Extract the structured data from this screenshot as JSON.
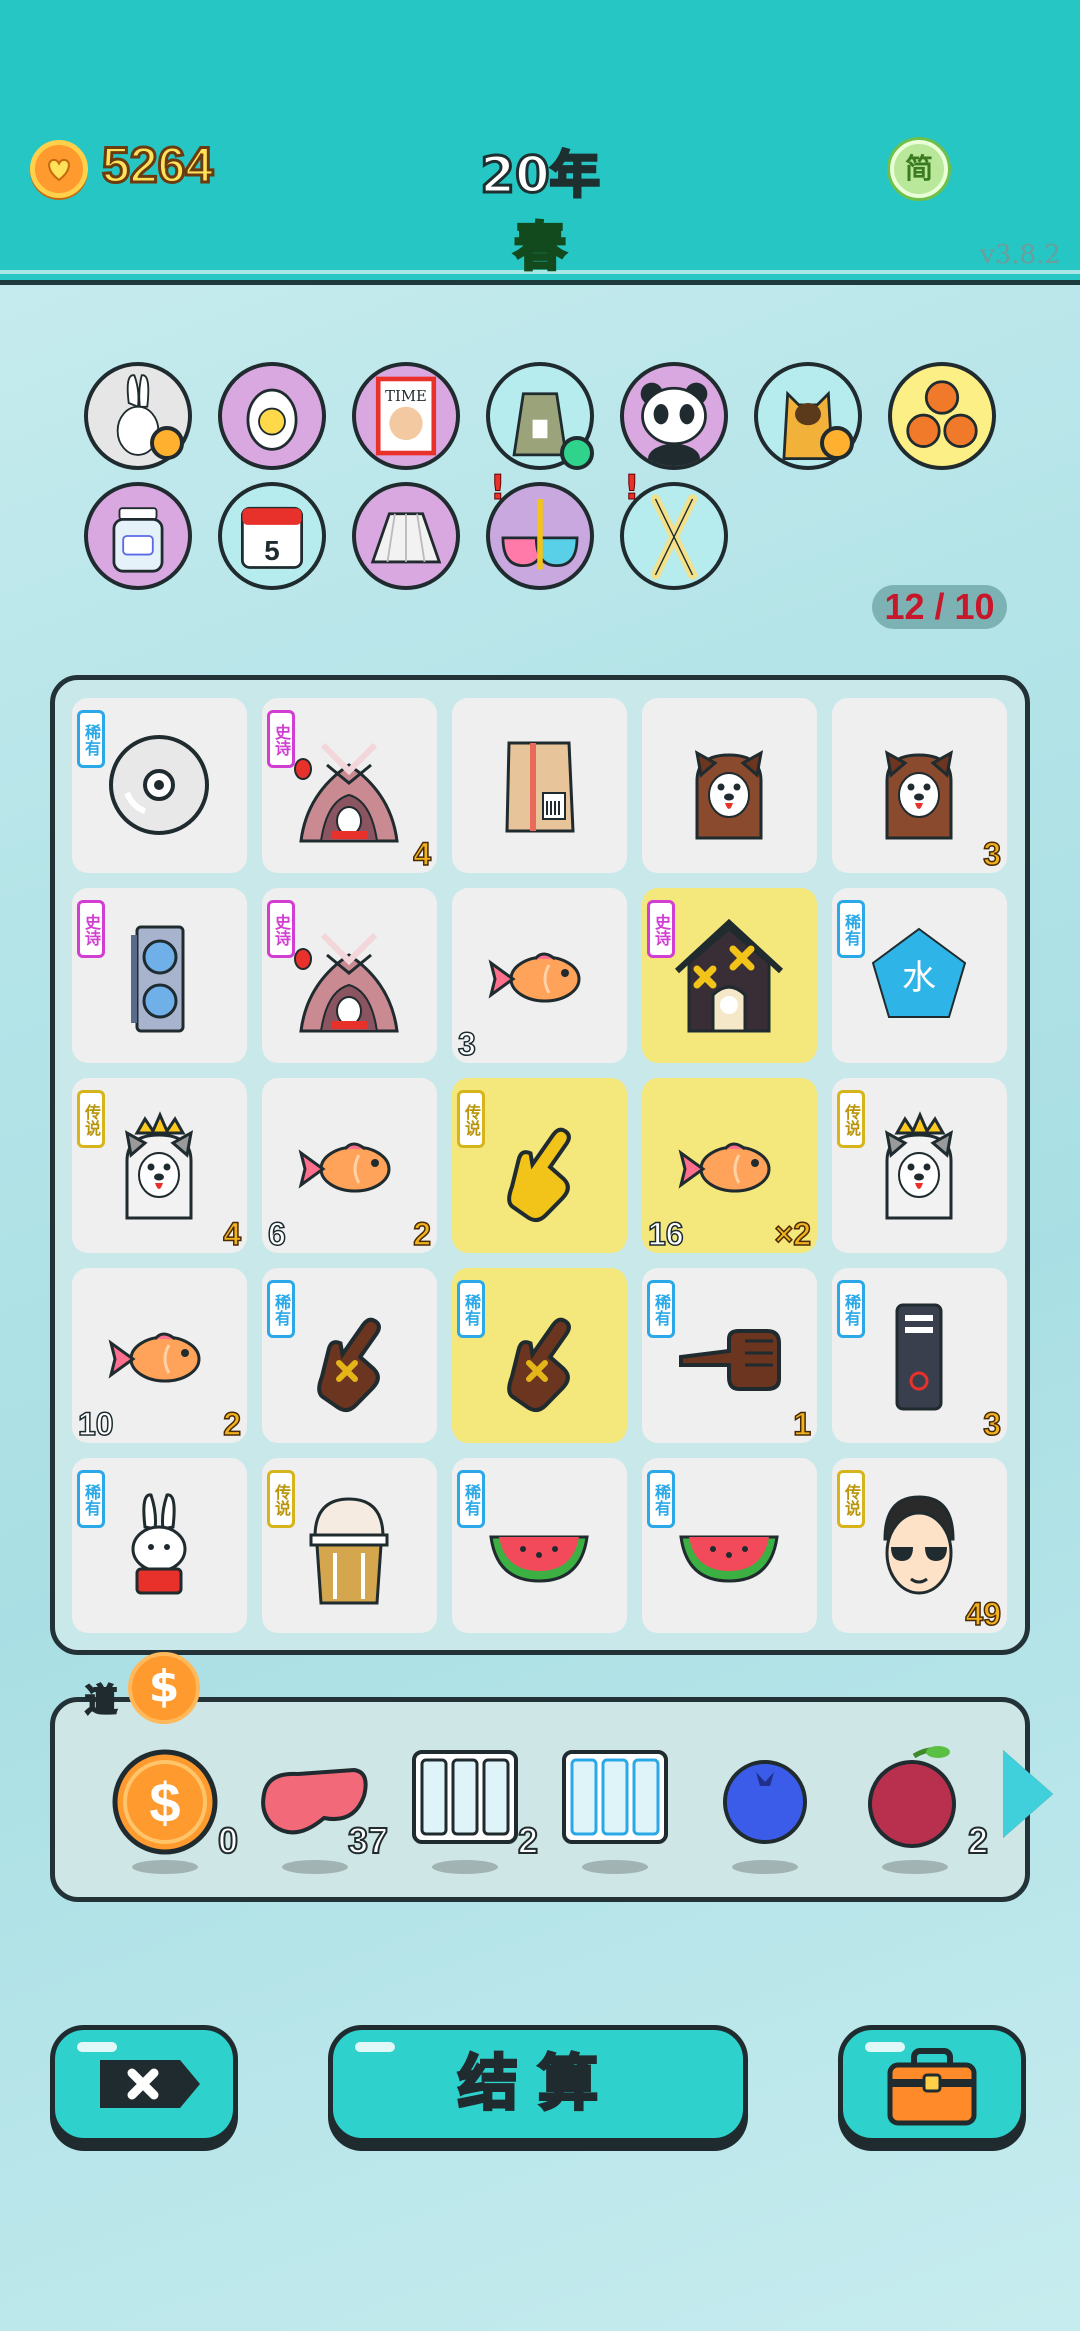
{
  "header": {
    "coins": "5264",
    "year": "20年",
    "season": "春",
    "lang_toggle": "简",
    "version": "v3.8.2"
  },
  "relics": [
    {
      "name": "rabbit-relic",
      "icon": "rabbit-icon",
      "bg": "#e6e6e6",
      "badge": true
    },
    {
      "name": "egg-relic",
      "icon": "egg-icon",
      "bg": "#d9a8e0"
    },
    {
      "name": "magazine-relic",
      "icon": "time-magazine-icon",
      "bg": "#d9a8e0",
      "text": "TIME"
    },
    {
      "name": "sack-relic",
      "icon": "sack-icon",
      "bg": "#b7ecee",
      "dot": true
    },
    {
      "name": "panda-relic",
      "icon": "panda-icon",
      "bg": "#d9a8e0"
    },
    {
      "name": "cat-relic",
      "icon": "cat-icon",
      "bg": "#b7ecee",
      "badge": true
    },
    {
      "name": "basketballs-relic",
      "icon": "basketballs-icon",
      "bg": "#fbef86"
    },
    {
      "name": "jar-relic",
      "icon": "jar-icon",
      "bg": "#d9a8e0"
    },
    {
      "name": "calendar-relic",
      "icon": "calendar-icon",
      "bg": "#b7ecee",
      "text": "5"
    },
    {
      "name": "skirt-relic",
      "icon": "skirt-icon",
      "bg": "#d9a8e0"
    },
    {
      "name": "bowls-relic",
      "icon": "bowls-icon",
      "bg": "#c9a8e0",
      "alert": true
    },
    {
      "name": "sticks-relic",
      "icon": "sticks-icon",
      "bg": "#b7ecee",
      "alert": true
    }
  ],
  "relic_counter": "12 / 10",
  "board": [
    [
      {
        "icon": "cd-disc-icon",
        "rarity": "稀有",
        "rclass": "r-rare"
      },
      {
        "icon": "rabbit-tent-icon",
        "rarity": "史诗",
        "rclass": "r-epic",
        "br": "4"
      },
      {
        "icon": "cardboard-box-icon"
      },
      {
        "icon": "husky-dog-icon"
      },
      {
        "icon": "husky-dog-icon",
        "br": "3"
      }
    ],
    [
      {
        "icon": "graphics-card-icon",
        "rarity": "史诗",
        "rclass": "r-epic"
      },
      {
        "icon": "rabbit-tent-icon",
        "rarity": "史诗",
        "rclass": "r-epic"
      },
      {
        "icon": "goldfish-icon",
        "bl": "3"
      },
      {
        "icon": "haunted-house-icon",
        "rarity": "史诗",
        "rclass": "r-epic",
        "hl": true
      },
      {
        "icon": "water-gem-icon",
        "rarity": "稀有",
        "rclass": "r-rare",
        "text": "水"
      }
    ],
    [
      {
        "icon": "crowned-husky-icon",
        "rarity": "传说",
        "rclass": "r-leg",
        "br": "4"
      },
      {
        "icon": "goldfish-icon",
        "bl": "6",
        "br": "2"
      },
      {
        "icon": "golden-pointer-icon",
        "rarity": "传说",
        "rclass": "r-leg",
        "hl": true
      },
      {
        "icon": "goldfish-icon",
        "bl": "16",
        "br": "×2",
        "hl": true
      },
      {
        "icon": "crowned-husky-icon",
        "rarity": "传说",
        "rclass": "r-leg"
      }
    ],
    [
      {
        "icon": "goldfish-icon",
        "bl": "10",
        "br": "2"
      },
      {
        "icon": "brown-pointer-icon",
        "rarity": "稀有",
        "rclass": "r-rare"
      },
      {
        "icon": "brown-pointer-icon",
        "rarity": "稀有",
        "rclass": "r-rare",
        "hl": true
      },
      {
        "icon": "brown-hand-icon",
        "rarity": "稀有",
        "rclass": "r-rare",
        "br": "1"
      },
      {
        "icon": "pc-tower-icon",
        "rarity": "稀有",
        "rclass": "r-rare",
        "br": "3"
      }
    ],
    [
      {
        "icon": "lucky-rabbit-icon",
        "rarity": "稀有",
        "rclass": "r-rare"
      },
      {
        "icon": "bubble-tea-icon",
        "rarity": "传说",
        "rclass": "r-leg"
      },
      {
        "icon": "watermelon-icon",
        "rarity": "稀有",
        "rclass": "r-rare"
      },
      {
        "icon": "watermelon-icon",
        "rarity": "稀有",
        "rclass": "r-rare"
      },
      {
        "icon": "sunglasses-man-icon",
        "rarity": "传说",
        "rclass": "r-leg",
        "br": "49"
      }
    ]
  ],
  "tray": {
    "label": "道",
    "coin_symbol": "$",
    "items": [
      {
        "name": "coin-item",
        "icon": "coin-icon",
        "count": "0"
      },
      {
        "name": "liver-item",
        "icon": "liver-icon",
        "count": "37"
      },
      {
        "name": "empty-slots-item",
        "icon": "slots-icon",
        "count": "2"
      },
      {
        "name": "rare-slots-item",
        "icon": "rare-slots-icon",
        "count": ""
      },
      {
        "name": "blueberry-item",
        "icon": "blueberry-icon",
        "count": ""
      },
      {
        "name": "lychee-item",
        "icon": "lychee-icon",
        "count": "2"
      }
    ]
  },
  "buttons": {
    "settle": "结算"
  }
}
